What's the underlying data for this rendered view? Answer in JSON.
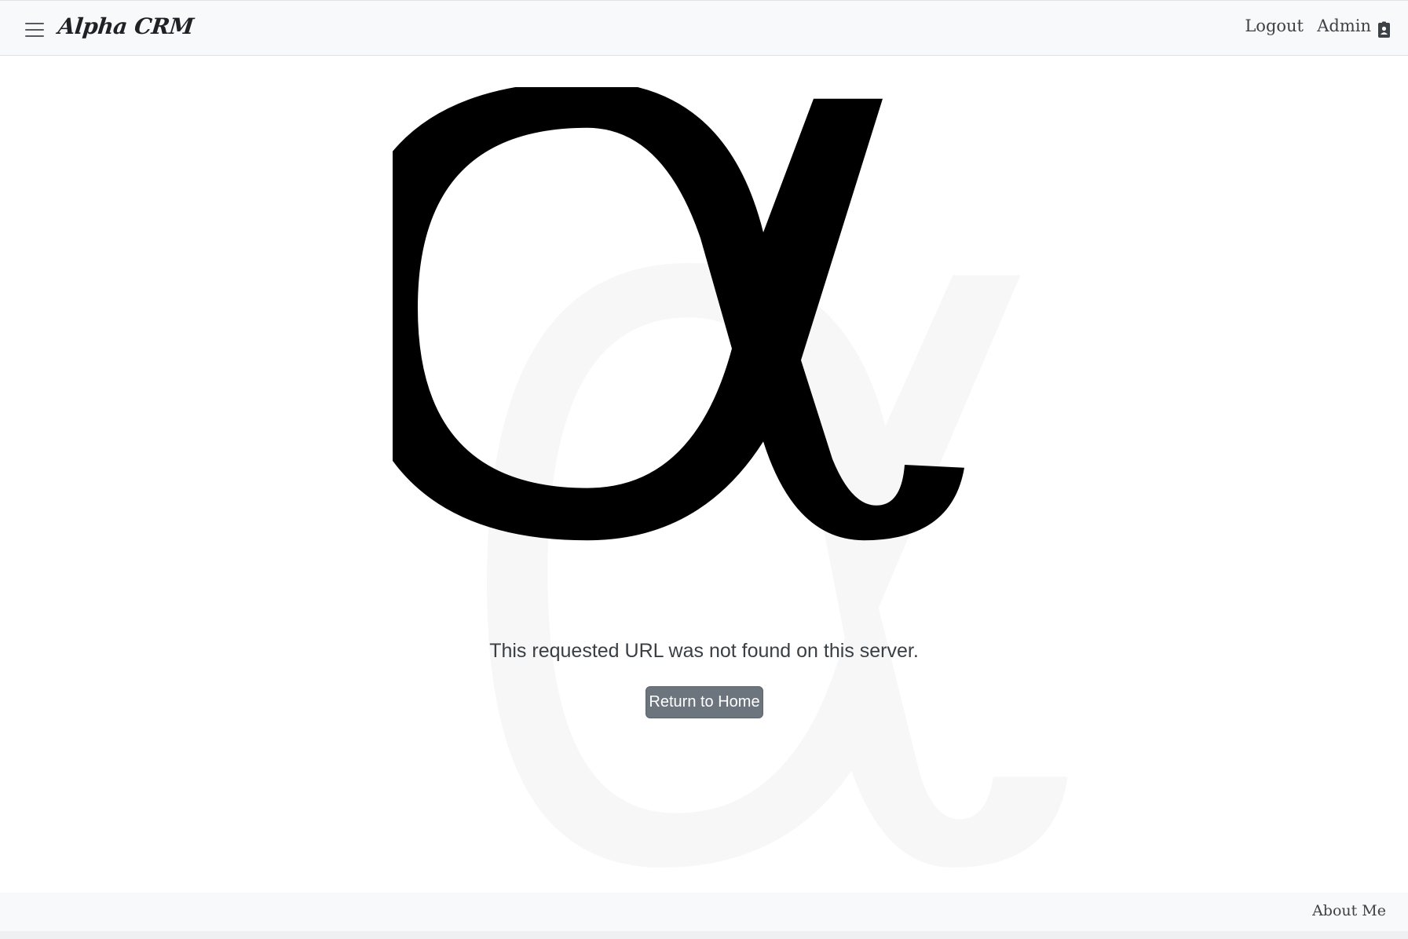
{
  "navbar": {
    "brand": "Alpha CRM",
    "logout_label": "Logout",
    "admin_label": "Admin",
    "menu_icon": "hamburger-icon",
    "user_icon": "id-badge-icon"
  },
  "main": {
    "logo_glyph": "alpha-logo",
    "message": "This requested URL was not found on this server.",
    "return_button_label": "Return to Home"
  },
  "footer": {
    "about_label": "About Me"
  },
  "colors": {
    "navbar_bg": "#f8f9fa",
    "button_bg": "#6c757d",
    "logo": "#000000",
    "watermark": "#f7f7f7"
  }
}
